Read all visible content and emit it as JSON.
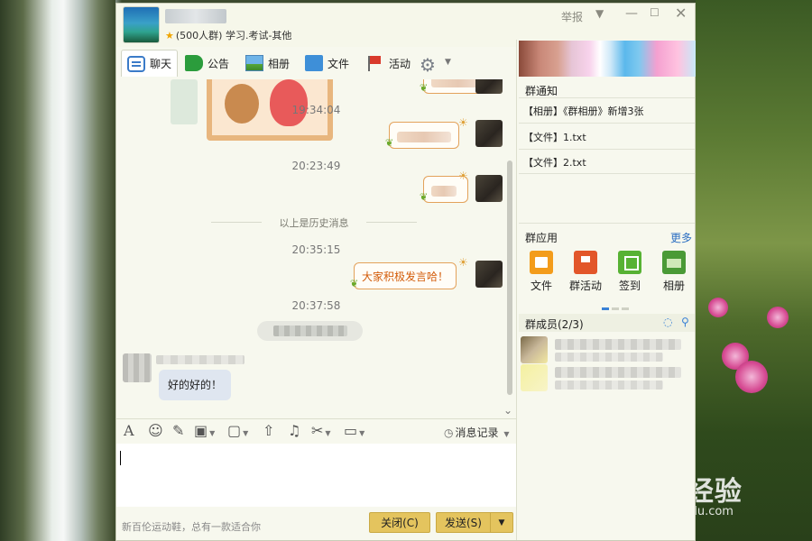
{
  "window": {
    "group_meta": "(500人群) 学习.考试-其他",
    "report_label": "举报"
  },
  "tabs": [
    {
      "label": "聊天",
      "icon": "chat-icon"
    },
    {
      "label": "公告",
      "icon": "notice-icon"
    },
    {
      "label": "相册",
      "icon": "photo-icon"
    },
    {
      "label": "文件",
      "icon": "folder-icon"
    },
    {
      "label": "活动",
      "icon": "flag-icon"
    }
  ],
  "chat": {
    "timestamps": [
      "19:34:04",
      "20:23:49",
      "20:35:15",
      "20:37:58"
    ],
    "history_divider": "以上是历史消息",
    "my_message": "大家积极发言哈！",
    "peer_message": "好的好的！"
  },
  "input": {
    "message_record_label": "消息记录",
    "ad_text": "新百伦运动鞋，总有一款适合你",
    "close_button": "关闭(C)",
    "send_button": "发送(S)"
  },
  "right_panel": {
    "notice_title": "群通知",
    "notices": [
      "【相册】《群相册》新增3张",
      "【文件】1.txt",
      "【文件】2.txt"
    ],
    "apps_title": "群应用",
    "more_label": "更多",
    "apps": [
      {
        "label": "文件",
        "icon": "file-app-icon"
      },
      {
        "label": "群活动",
        "icon": "event-app-icon"
      },
      {
        "label": "签到",
        "icon": "checkin-app-icon"
      },
      {
        "label": "相册",
        "icon": "album-app-icon"
      }
    ],
    "members_title": "群成员(2/3)"
  },
  "watermark": {
    "brand": "Bai 经验",
    "url": "jingyan.baidu.com"
  },
  "colors": {
    "accent_orange": "#d35c0a",
    "button_gold": "#e4c45e",
    "link_blue": "#2b6ec2"
  }
}
